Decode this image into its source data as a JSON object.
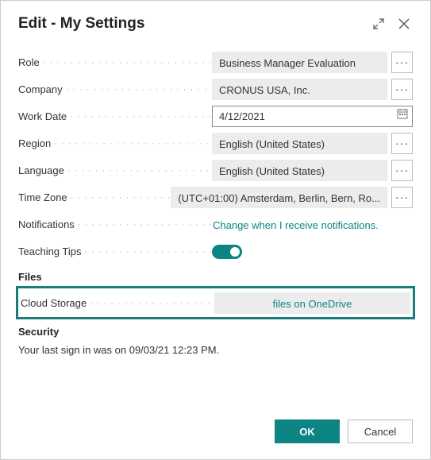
{
  "header": {
    "title": "Edit - My Settings"
  },
  "fields": {
    "role": {
      "label": "Role",
      "value": "Business Manager Evaluation"
    },
    "company": {
      "label": "Company",
      "value": "CRONUS USA, Inc."
    },
    "workDate": {
      "label": "Work Date",
      "value": "4/12/2021"
    },
    "region": {
      "label": "Region",
      "value": "English (United States)"
    },
    "language": {
      "label": "Language",
      "value": "English (United States)"
    },
    "timeZone": {
      "label": "Time Zone",
      "value": "(UTC+01:00) Amsterdam, Berlin, Bern, Ro..."
    },
    "notifications": {
      "label": "Notifications",
      "link": "Change when I receive notifications."
    },
    "teachingTips": {
      "label": "Teaching Tips",
      "on": true
    },
    "cloudStorage": {
      "label": "Cloud Storage",
      "value": "files on OneDrive"
    }
  },
  "sections": {
    "files": "Files",
    "security": "Security"
  },
  "security": {
    "lastSignIn": "Your last sign in was on 09/03/21 12:23 PM."
  },
  "footer": {
    "ok": "OK",
    "cancel": "Cancel"
  },
  "ellipsis": "···"
}
